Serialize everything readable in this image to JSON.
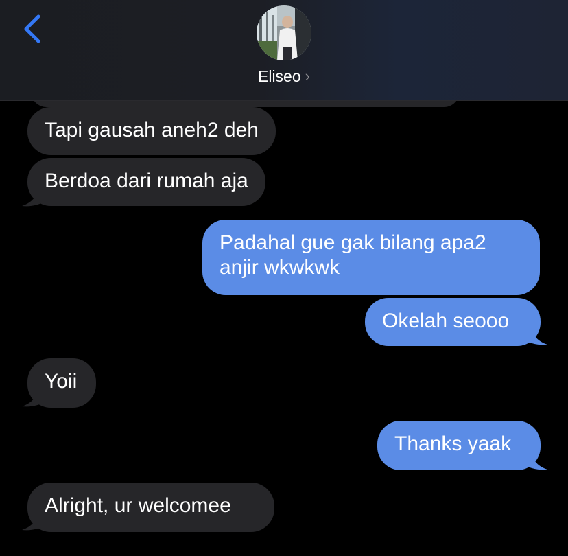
{
  "header": {
    "back_icon": "chevron-left-icon",
    "contact_name": "Eliseo",
    "contact_chevron": "›",
    "accent_color": "#3478f6"
  },
  "messages": [
    {
      "direction": "received",
      "text": "Tapi gausah aneh2 deh"
    },
    {
      "direction": "received",
      "text": "Berdoa dari rumah aja"
    },
    {
      "direction": "sent",
      "text_line1": "Padahal gue gak bilang apa2",
      "text_line2": "anjir wkwkwk"
    },
    {
      "direction": "sent",
      "text": "Okelah seooo"
    },
    {
      "direction": "received",
      "text": "Yoii"
    },
    {
      "direction": "sent",
      "text": "Thanks yaak"
    },
    {
      "direction": "received",
      "text": "Alright, ur welcomee"
    }
  ],
  "colors": {
    "received_bubble": "#262629",
    "sent_bubble": "#5b8ce6",
    "background": "#000000"
  }
}
